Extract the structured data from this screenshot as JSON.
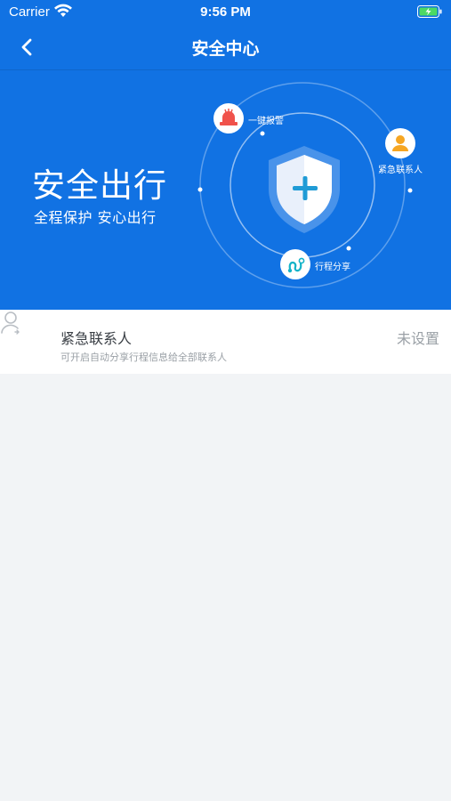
{
  "status_bar": {
    "carrier": "Carrier",
    "time": "9:56 PM"
  },
  "nav": {
    "title": "安全中心"
  },
  "hero": {
    "title": "安全出行",
    "subtitle": "全程保护  安心出行",
    "labels": {
      "alarm": "一键报警",
      "contact": "紧急联系人",
      "share": "行程分享"
    }
  },
  "emergency_row": {
    "title": "紧急联系人",
    "description": "可开启自动分享行程信息给全部联系人",
    "status": "未设置"
  },
  "colors": {
    "primary": "#1172e3",
    "background": "#f2f4f6",
    "alarm_red": "#f0524b",
    "contact_orange": "#f6a623",
    "share_teal": "#14b3c8"
  }
}
